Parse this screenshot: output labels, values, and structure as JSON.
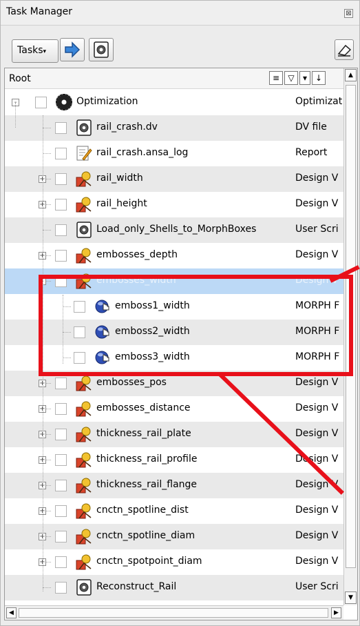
{
  "window": {
    "title": "Task Manager",
    "close_glyph": "⊠"
  },
  "toolbar": {
    "tasks_label": "Tasks",
    "arrow_icon": "right-arrow-icon",
    "gear_icon": "gear-icon",
    "eraser_icon": "eraser-icon"
  },
  "tree": {
    "root_label": "Root",
    "rows": [
      {
        "label": "Optimization",
        "type": "Optimizat",
        "icon": "optimization-gear-icon"
      },
      {
        "label": "rail_crash.dv",
        "type": "DV file",
        "icon": "script-gear-icon"
      },
      {
        "label": "rail_crash.ansa_log",
        "type": "Report",
        "icon": "report-pencil-icon"
      },
      {
        "label": "rail_width",
        "type": "Design V",
        "icon": "design-variable-icon"
      },
      {
        "label": "rail_height",
        "type": "Design V",
        "icon": "design-variable-icon"
      },
      {
        "label": "Load_only_Shells_to_MorphBoxes",
        "type": "User Scri",
        "icon": "script-gear-icon"
      },
      {
        "label": "embosses_depth",
        "type": "Design V",
        "icon": "design-variable-icon"
      },
      {
        "label": "embosses_width",
        "type": "Design V",
        "icon": "design-variable-icon"
      },
      {
        "label": "emboss1_width",
        "type": "MORPH F",
        "icon": "morph-hand-icon"
      },
      {
        "label": "emboss2_width",
        "type": "MORPH F",
        "icon": "morph-hand-icon"
      },
      {
        "label": "emboss3_width",
        "type": "MORPH F",
        "icon": "morph-hand-icon"
      },
      {
        "label": "embosses_pos",
        "type": "Design V",
        "icon": "design-variable-icon"
      },
      {
        "label": "embosses_distance",
        "type": "Design V",
        "icon": "design-variable-icon"
      },
      {
        "label": "thickness_rail_plate",
        "type": "Design V",
        "icon": "design-variable-icon"
      },
      {
        "label": "thickness_rail_profile",
        "type": "Design V",
        "icon": "design-variable-icon"
      },
      {
        "label": "thickness_rail_flange",
        "type": "Design V",
        "icon": "design-variable-icon"
      },
      {
        "label": "cnctn_spotline_dist",
        "type": "Design V",
        "icon": "design-variable-icon"
      },
      {
        "label": "cnctn_spotline_diam",
        "type": "Design V",
        "icon": "design-variable-icon"
      },
      {
        "label": "cnctn_spotpoint_diam",
        "type": "Design V",
        "icon": "design-variable-icon"
      },
      {
        "label": "Reconstruct_Rail",
        "type": "User Scri",
        "icon": "script-gear-icon"
      }
    ]
  },
  "colors": {
    "highlight": "#e8101a",
    "selection": "#bcd9f6"
  }
}
